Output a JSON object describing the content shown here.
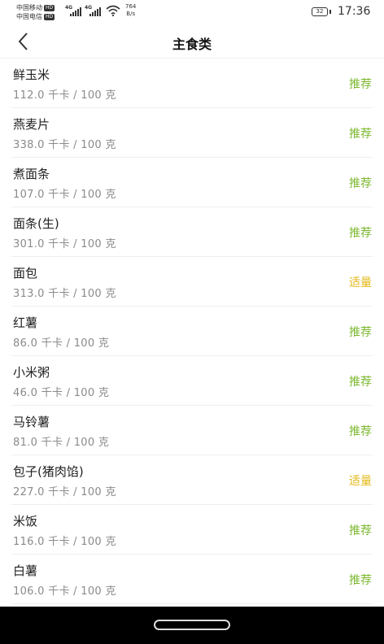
{
  "status_bar": {
    "carrier1": "中国移动",
    "carrier2": "中国电信",
    "hd_badge": "HD",
    "network1": "4G",
    "network2": "4G",
    "speed_value": "764",
    "speed_unit": "B/s",
    "battery": "32",
    "time": "17:36"
  },
  "header": {
    "title": "主食类"
  },
  "colors": {
    "recommend": "#7cb82f",
    "moderate": "#e3b715"
  },
  "foods": [
    {
      "name": "鲜玉米",
      "calories": "112.0 千卡 / 100 克",
      "tag": "推荐",
      "tag_type": "recommend"
    },
    {
      "name": "燕麦片",
      "calories": "338.0 千卡 / 100 克",
      "tag": "推荐",
      "tag_type": "recommend"
    },
    {
      "name": "煮面条",
      "calories": "107.0 千卡 / 100 克",
      "tag": "推荐",
      "tag_type": "recommend"
    },
    {
      "name": "面条(生)",
      "calories": "301.0 千卡 / 100 克",
      "tag": "推荐",
      "tag_type": "recommend"
    },
    {
      "name": "面包",
      "calories": "313.0 千卡 / 100 克",
      "tag": "适量",
      "tag_type": "moderate"
    },
    {
      "name": "红薯",
      "calories": "86.0 千卡 / 100 克",
      "tag": "推荐",
      "tag_type": "recommend"
    },
    {
      "name": "小米粥",
      "calories": "46.0 千卡 / 100 克",
      "tag": "推荐",
      "tag_type": "recommend"
    },
    {
      "name": "马铃薯",
      "calories": "81.0 千卡 / 100 克",
      "tag": "推荐",
      "tag_type": "recommend"
    },
    {
      "name": "包子(猪肉馅)",
      "calories": "227.0 千卡 / 100 克",
      "tag": "适量",
      "tag_type": "moderate"
    },
    {
      "name": "米饭",
      "calories": "116.0 千卡 / 100 克",
      "tag": "推荐",
      "tag_type": "recommend"
    },
    {
      "name": "白薯",
      "calories": "106.0 千卡 / 100 克",
      "tag": "推荐",
      "tag_type": "recommend"
    }
  ]
}
